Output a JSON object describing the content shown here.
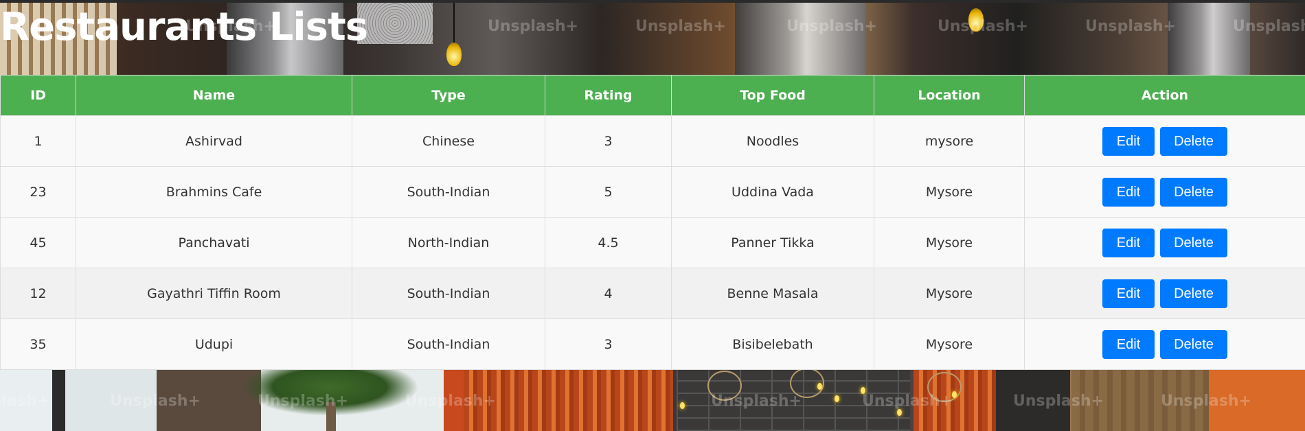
{
  "page": {
    "title": "Restaurants Lists",
    "watermark": "Unsplash+"
  },
  "colors": {
    "header_bg": "#4caf50",
    "header_text": "#ffffff",
    "row_bg": "#f9f9f9",
    "row_highlight_bg": "#f1f1f1",
    "button_bg": "#007bff",
    "button_text": "#ffffff"
  },
  "table": {
    "columns": [
      "ID",
      "Name",
      "Type",
      "Rating",
      "Top Food",
      "Location",
      "Action"
    ],
    "rows": [
      {
        "id": "1",
        "name": "Ashirvad",
        "type": "Chinese",
        "rating": "3",
        "top_food": "Noodles",
        "location": "mysore",
        "edit_label": "Edit",
        "delete_label": "Delete"
      },
      {
        "id": "23",
        "name": "Brahmins Cafe",
        "type": "South-Indian",
        "rating": "5",
        "top_food": "Uddina Vada",
        "location": "Mysore",
        "edit_label": "Edit",
        "delete_label": "Delete"
      },
      {
        "id": "45",
        "name": "Panchavati",
        "type": "North-Indian",
        "rating": "4.5",
        "top_food": "Panner Tikka",
        "location": "Mysore",
        "edit_label": "Edit",
        "delete_label": "Delete"
      },
      {
        "id": "12",
        "name": "Gayathri Tiffin Room",
        "type": "South-Indian",
        "rating": "4",
        "top_food": "Benne Masala",
        "location": "Mysore",
        "edit_label": "Edit",
        "delete_label": "Delete"
      },
      {
        "id": "35",
        "name": "Udupi",
        "type": "South-Indian",
        "rating": "3",
        "top_food": "Bisibelebath",
        "location": "Mysore",
        "edit_label": "Edit",
        "delete_label": "Delete"
      }
    ]
  }
}
